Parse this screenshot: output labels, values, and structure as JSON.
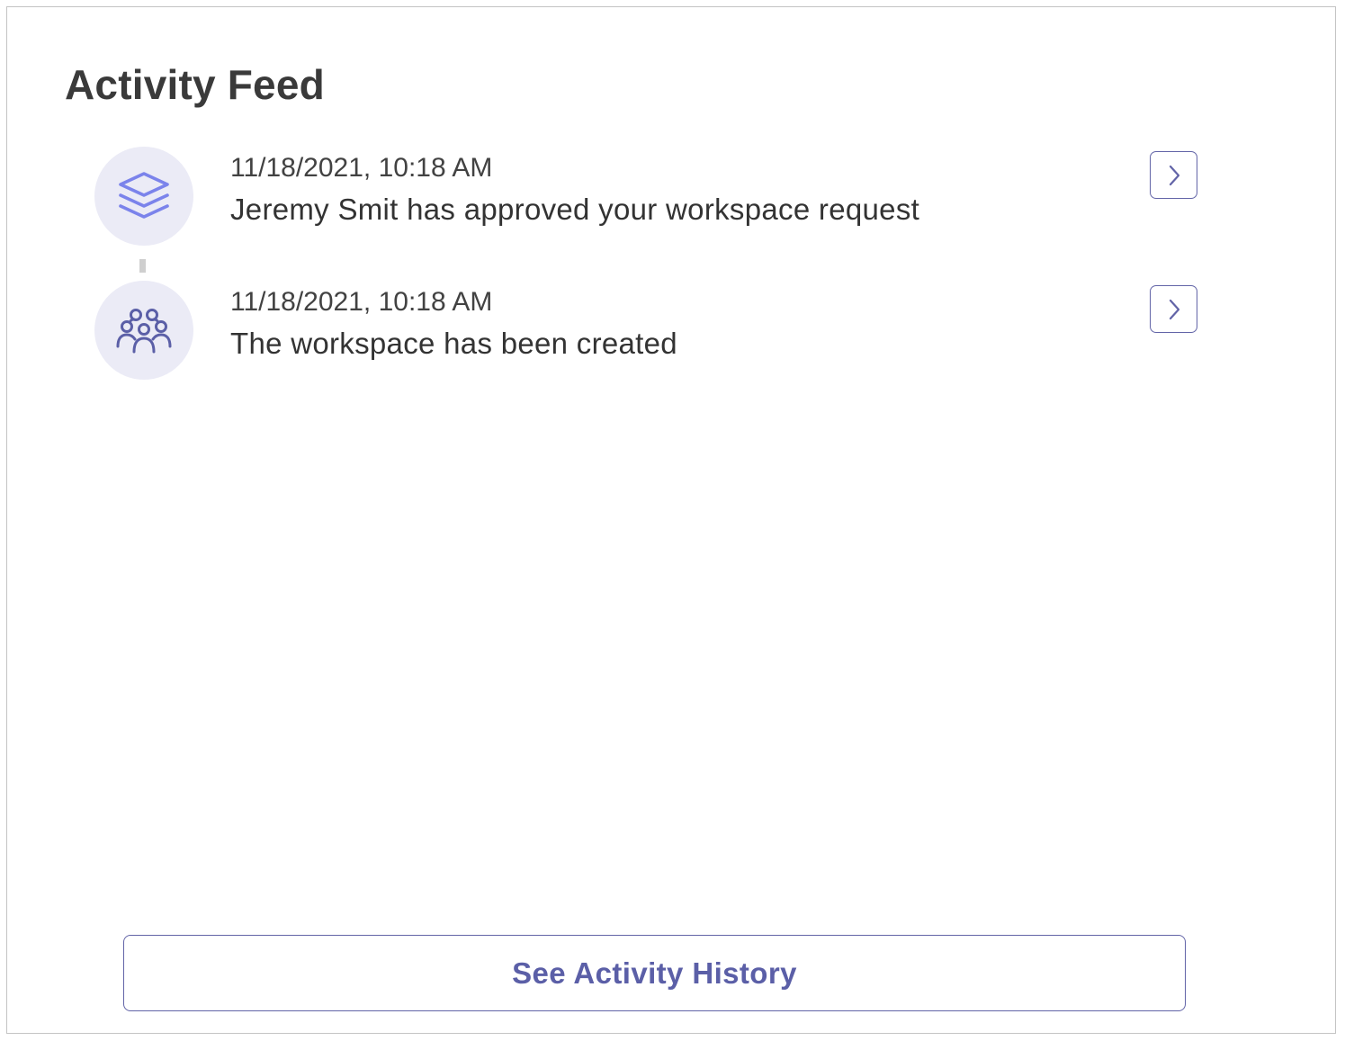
{
  "feed": {
    "title": "Activity Feed",
    "items": [
      {
        "icon": "layers-icon",
        "timestamp": "11/18/2021, 10:18 AM",
        "message": "Jeremy Smit has approved your workspace request"
      },
      {
        "icon": "people-group-icon",
        "timestamp": "11/18/2021, 10:18 AM",
        "message": "The workspace has been created"
      }
    ]
  },
  "footer": {
    "history_label": "See Activity History"
  },
  "colors": {
    "accent": "#6264a7",
    "icon_bg": "#ebebf6",
    "layers_icon": "#7b83eb",
    "people_icon": "#5b5fa7",
    "border": "#c4c4c4"
  }
}
